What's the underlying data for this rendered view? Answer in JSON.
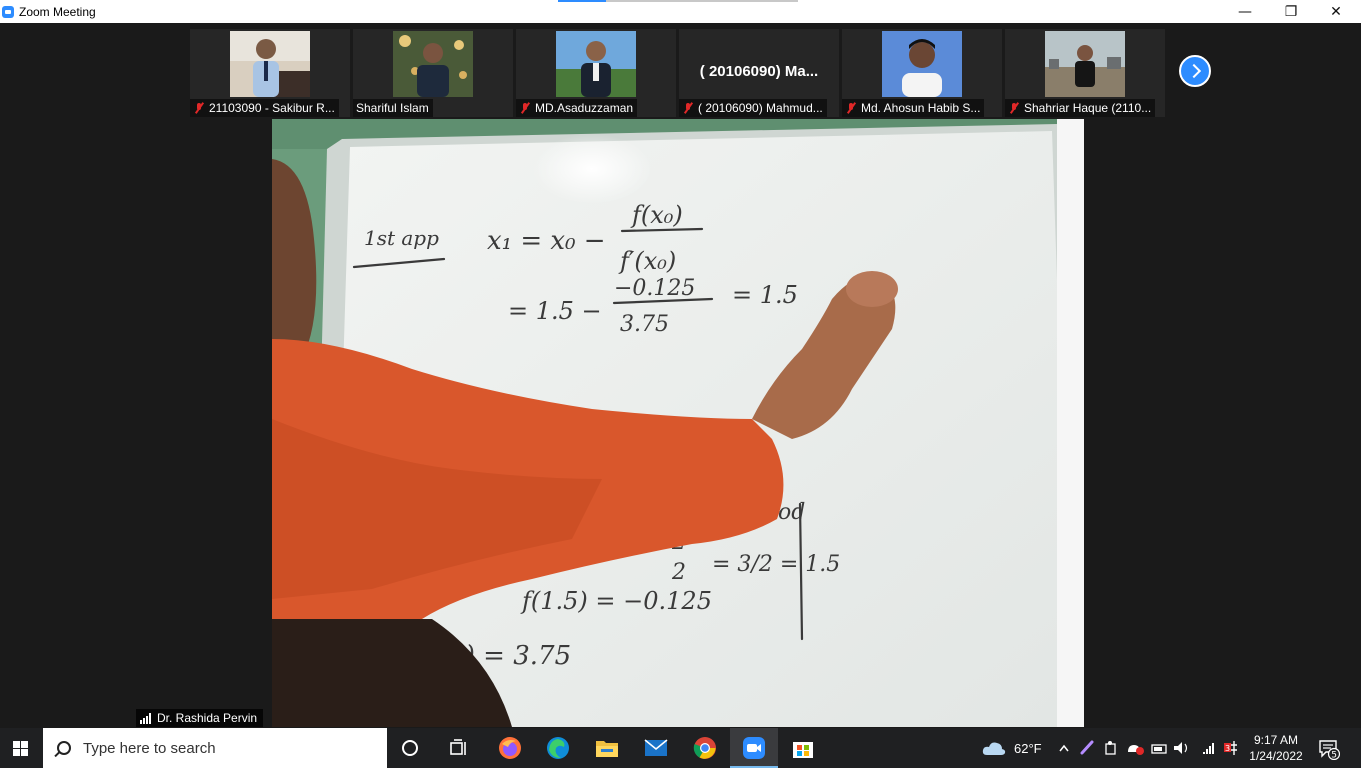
{
  "window": {
    "title": "Zoom Meeting",
    "minimize": "—",
    "maximize": "❐",
    "close": "✕"
  },
  "participants": [
    {
      "name": "21103090 - Sakibur R...",
      "muted": true,
      "has_video": true
    },
    {
      "name": "Shariful Islam",
      "muted": false,
      "has_video": true
    },
    {
      "name": "MD.Asaduzzaman",
      "muted": true,
      "has_video": true
    },
    {
      "name": "( 20106090) Mahmud...",
      "muted": true,
      "has_video": false,
      "display_name": "( 20106090) Ma..."
    },
    {
      "name": "Md. Ahosun Habib S...",
      "muted": true,
      "has_video": true
    },
    {
      "name": "Shahriar Haque (2110...",
      "muted": true,
      "has_video": true
    }
  ],
  "main_video": {
    "speaker": "Dr. Rashida Pervin",
    "whiteboard": {
      "line1_label": "1st app",
      "line1_lhs": "x₁ = x₀ −",
      "line1_num": "f(x₀)",
      "line1_den": "f′(x₀)",
      "line2_prefix": "= 1.5 −",
      "line2_num": "−0.125",
      "line2_den": "3.75",
      "line2_result": "= 1.5",
      "lower_word": "ethod",
      "lower_frac_num": "2",
      "lower_frac_den": "2",
      "lower_eq": "= 3/2 = 1.5",
      "lower_f": "f(1.5) = −0.125",
      "lower_fprime": "f′(x₀) = 3.75"
    }
  },
  "taskbar": {
    "search_placeholder": "Type here to search",
    "weather": "62°F",
    "time": "9:17 AM",
    "date": "1/24/2022",
    "notification_count": "5",
    "colors": {
      "zoom": "#2d8cff",
      "taskbar": "#1f2022"
    }
  }
}
